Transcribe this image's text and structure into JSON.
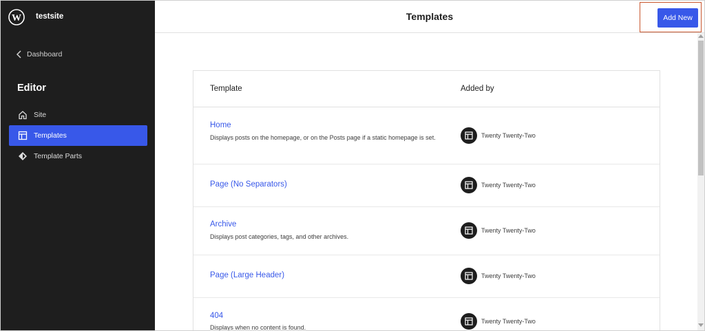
{
  "site": {
    "name": "testsite"
  },
  "sidebar": {
    "back_label": "Dashboard",
    "section_title": "Editor",
    "items": [
      {
        "label": "Site",
        "icon": "home-icon",
        "active": false
      },
      {
        "label": "Templates",
        "icon": "layout-icon",
        "active": true
      },
      {
        "label": "Template Parts",
        "icon": "diamond-icon",
        "active": false
      }
    ]
  },
  "header": {
    "title": "Templates",
    "add_new_label": "Add New"
  },
  "table": {
    "columns": [
      "Template",
      "Added by"
    ],
    "rows": [
      {
        "name": "Home",
        "description": "Displays posts on the homepage, or on the Posts page if a static homepage is set.",
        "author": "Twenty Twenty-Two"
      },
      {
        "name": "Page (No Separators)",
        "description": "",
        "author": "Twenty Twenty-Two"
      },
      {
        "name": "Archive",
        "description": "Displays post categories, tags, and other archives.",
        "author": "Twenty Twenty-Two"
      },
      {
        "name": "Page (Large Header)",
        "description": "",
        "author": "Twenty Twenty-Two"
      },
      {
        "name": "404",
        "description": "Displays when no content is found.",
        "author": "Twenty Twenty-Two"
      }
    ]
  },
  "colors": {
    "accent": "#3858e9",
    "sidebar_bg": "#1e1e1e",
    "highlight_border": "#c9572f"
  }
}
